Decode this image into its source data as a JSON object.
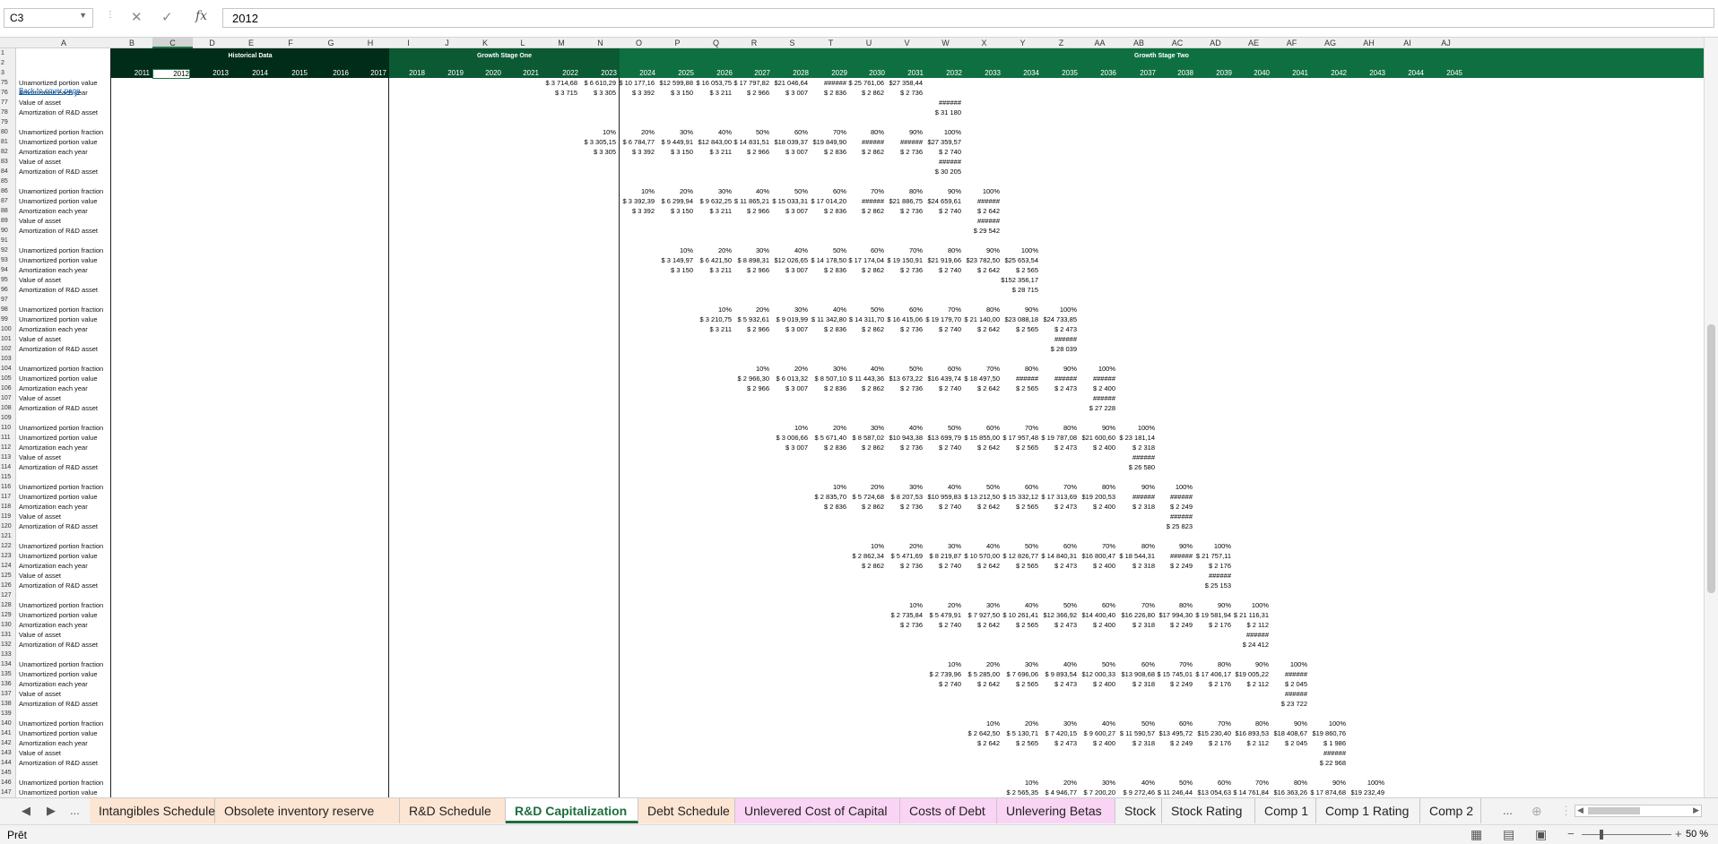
{
  "namebox": "C3",
  "formula": "2012",
  "back_link": "Back to cover page",
  "bands": {
    "hist": "Historical Data",
    "gs1": "Growth Stage One",
    "gs2": "Growth Stage Two"
  },
  "colors": {
    "dark_green": "#002d1a",
    "mid_green": "#0b5a34",
    "bright_green": "#0e7040",
    "accent": "#217346"
  },
  "columns": [
    "A",
    "B",
    "C",
    "D",
    "E",
    "F",
    "G",
    "H",
    "I",
    "J",
    "K",
    "L",
    "M",
    "N",
    "O",
    "P",
    "Q",
    "R",
    "S",
    "T",
    "U",
    "V",
    "W",
    "X",
    "Y",
    "Z",
    "AA",
    "AB",
    "AC",
    "AD",
    "AE",
    "AF",
    "AG",
    "AH",
    "AI",
    "AJ"
  ],
  "years": [
    "2011",
    "2012",
    "2013",
    "2014",
    "2015",
    "2016",
    "2017",
    "2018",
    "2019",
    "2020",
    "2021",
    "2022",
    "2023",
    "2024",
    "2025",
    "2026",
    "2027",
    "2028",
    "2029",
    "2030",
    "2031",
    "2032",
    "2033",
    "2034",
    "2035",
    "2036",
    "2037",
    "2038",
    "2039",
    "2040",
    "2041",
    "2042",
    "2043",
    "2044",
    "2045"
  ],
  "row_numbers": [
    "1",
    "2",
    "3",
    "75",
    "76",
    "77",
    "78",
    "79",
    "80",
    "81",
    "82",
    "83",
    "84",
    "85",
    "86",
    "87",
    "88",
    "89",
    "90",
    "91",
    "92",
    "93",
    "94",
    "95",
    "96",
    "97",
    "98",
    "99",
    "100",
    "101",
    "102",
    "103",
    "104",
    "105",
    "106",
    "107",
    "108",
    "109",
    "110",
    "111",
    "112",
    "113",
    "114",
    "115",
    "116",
    "117",
    "118",
    "119",
    "120",
    "121",
    "122",
    "123",
    "124",
    "125",
    "126",
    "127",
    "128",
    "129",
    "130",
    "131",
    "132",
    "133",
    "134",
    "135",
    "136",
    "137",
    "138",
    "139",
    "140",
    "141",
    "142",
    "143",
    "144",
    "145",
    "146",
    "147"
  ],
  "labels": {
    "frac": "Unamortized portion fraction",
    "val": "Unamortized portion value",
    "amort": "Amortization each year",
    "asset": "Value of asset",
    "rd": "Amortization of R&D asset"
  },
  "top_rows": {
    "r75": [
      "$ 3 714,68",
      "$ 6 610,29",
      "$ 10 177,16",
      "$12 599,88",
      "$ 16 053,75",
      "$ 17 797,82",
      "$21 046,64",
      "######",
      "$ 25 761,06",
      "$27 358,44"
    ],
    "r76": [
      "$ 3 715",
      "$ 3 305",
      "$ 3 392",
      "$ 3 150",
      "$ 3 211",
      "$ 2 966",
      "$ 3 007",
      "$ 2 836",
      "$ 2 862",
      "$ 2 736"
    ],
    "r77": [
      "######"
    ],
    "r78": [
      "$ 31 180"
    ]
  },
  "blocks": [
    {
      "frac": [
        "10%",
        "20%",
        "30%",
        "40%",
        "50%",
        "60%",
        "70%",
        "80%",
        "90%",
        "100%"
      ],
      "val": [
        "$ 3 305,15",
        "$ 6 784,77",
        "$ 9 449,91",
        "$12 843,00",
        "$ 14 831,51",
        "$18 039,37",
        "$19 849,90",
        "######",
        "######",
        "$27 359,57"
      ],
      "amort": [
        "$ 3 305",
        "$ 3 392",
        "$ 3 150",
        "$ 3 211",
        "$ 2 966",
        "$ 3 007",
        "$ 2 836",
        "$ 2 862",
        "$ 2 736",
        "$ 2 740"
      ],
      "asset": "######",
      "rd": "$ 30 205"
    },
    {
      "frac": [
        "10%",
        "20%",
        "30%",
        "40%",
        "50%",
        "60%",
        "70%",
        "80%",
        "90%",
        "100%"
      ],
      "val": [
        "$ 3 392,39",
        "$ 6 299,94",
        "$ 9 632,25",
        "$ 11 865,21",
        "$ 15 033,31",
        "$ 17 014,20",
        "######",
        "$21 886,75",
        "$24 659,61",
        "######"
      ],
      "amort": [
        "$ 3 392",
        "$ 3 150",
        "$ 3 211",
        "$ 2 966",
        "$ 3 007",
        "$ 2 836",
        "$ 2 862",
        "$ 2 736",
        "$ 2 740",
        "$ 2 642"
      ],
      "asset": "######",
      "rd": "$ 29 542"
    },
    {
      "frac": [
        "10%",
        "20%",
        "30%",
        "40%",
        "50%",
        "60%",
        "70%",
        "80%",
        "90%",
        "100%"
      ],
      "val": [
        "$ 3 149,97",
        "$ 6 421,50",
        "$ 8 898,31",
        "$12 026,65",
        "$ 14 178,50",
        "$ 17 174,04",
        "$ 19 150,91",
        "$21 919,66",
        "$23 782,50",
        "$25 653,54"
      ],
      "amort": [
        "$ 3 150",
        "$ 3 211",
        "$ 2 966",
        "$ 3 007",
        "$ 2 836",
        "$ 2 862",
        "$ 2 736",
        "$ 2 740",
        "$ 2 642",
        "$ 2 565"
      ],
      "asset": "$152 356,17",
      "rd": "$ 28 715"
    },
    {
      "frac": [
        "10%",
        "20%",
        "30%",
        "40%",
        "50%",
        "60%",
        "70%",
        "80%",
        "90%",
        "100%"
      ],
      "val": [
        "$ 3 210,75",
        "$ 5 932,61",
        "$ 9 019,99",
        "$ 11 342,80",
        "$ 14 311,70",
        "$ 16 415,06",
        "$ 19 179,70",
        "$ 21 140,00",
        "$23 088,18",
        "$24 733,85"
      ],
      "amort": [
        "$ 3 211",
        "$ 2 966",
        "$ 3 007",
        "$ 2 836",
        "$ 2 862",
        "$ 2 736",
        "$ 2 740",
        "$ 2 642",
        "$ 2 565",
        "$ 2 473"
      ],
      "asset": "######",
      "rd": "$ 28 039"
    },
    {
      "frac": [
        "10%",
        "20%",
        "30%",
        "40%",
        "50%",
        "60%",
        "70%",
        "80%",
        "90%",
        "100%"
      ],
      "val": [
        "$ 2 966,30",
        "$ 6 013,32",
        "$ 8 507,10",
        "$ 11 443,36",
        "$13 673,22",
        "$16 439,74",
        "$ 18 497,50",
        "######",
        "######",
        "######"
      ],
      "amort": [
        "$ 2 966",
        "$ 3 007",
        "$ 2 836",
        "$ 2 862",
        "$ 2 736",
        "$ 2 740",
        "$ 2 642",
        "$ 2 565",
        "$ 2 473",
        "$ 2 400"
      ],
      "asset": "######",
      "rd": "$ 27 228"
    },
    {
      "frac": [
        "10%",
        "20%",
        "30%",
        "40%",
        "50%",
        "60%",
        "70%",
        "80%",
        "90%",
        "100%"
      ],
      "val": [
        "$ 3 006,66",
        "$ 5 671,40",
        "$ 8 587,02",
        "$10 943,38",
        "$13 699,79",
        "$ 15 855,00",
        "$ 17 957,48",
        "$ 19 787,08",
        "$21 600,60",
        "$ 23 181,14"
      ],
      "amort": [
        "$ 3 007",
        "$ 2 836",
        "$ 2 862",
        "$ 2 736",
        "$ 2 740",
        "$ 2 642",
        "$ 2 565",
        "$ 2 473",
        "$ 2 400",
        "$ 2 318"
      ],
      "asset": "######",
      "rd": "$ 26 580"
    },
    {
      "frac": [
        "10%",
        "20%",
        "30%",
        "40%",
        "50%",
        "60%",
        "70%",
        "80%",
        "90%",
        "100%"
      ],
      "val": [
        "$ 2 835,70",
        "$ 5 724,68",
        "$ 8 207,53",
        "$10 959,83",
        "$ 13 212,50",
        "$ 15 332,12",
        "$ 17 313,69",
        "$19 200,53",
        "######",
        "######"
      ],
      "amort": [
        "$ 2 836",
        "$ 2 862",
        "$ 2 736",
        "$ 2 740",
        "$ 2 642",
        "$ 2 565",
        "$ 2 473",
        "$ 2 400",
        "$ 2 318",
        "$ 2 249"
      ],
      "asset": "######",
      "rd": "$ 25 823"
    },
    {
      "frac": [
        "10%",
        "20%",
        "30%",
        "40%",
        "50%",
        "60%",
        "70%",
        "80%",
        "90%",
        "100%"
      ],
      "val": [
        "$ 2 862,34",
        "$ 5 471,69",
        "$ 8 219,87",
        "$ 10 570,00",
        "$ 12 826,77",
        "$ 14 840,31",
        "$16 800,47",
        "$ 18 544,31",
        "######",
        "$ 21 757,11"
      ],
      "amort": [
        "$ 2 862",
        "$ 2 736",
        "$ 2 740",
        "$ 2 642",
        "$ 2 565",
        "$ 2 473",
        "$ 2 400",
        "$ 2 318",
        "$ 2 249",
        "$ 2 176"
      ],
      "asset": "######",
      "rd": "$ 25 153"
    },
    {
      "frac": [
        "10%",
        "20%",
        "30%",
        "40%",
        "50%",
        "60%",
        "70%",
        "80%",
        "90%",
        "100%"
      ],
      "val": [
        "$ 2 735,84",
        "$ 5 479,91",
        "$ 7 927,50",
        "$ 10 261,41",
        "$12 366,92",
        "$14 400,40",
        "$16 226,80",
        "$17 994,30",
        "$ 19 581,94",
        "$ 21 116,31"
      ],
      "amort": [
        "$ 2 736",
        "$ 2 740",
        "$ 2 642",
        "$ 2 565",
        "$ 2 473",
        "$ 2 400",
        "$ 2 318",
        "$ 2 249",
        "$ 2 176",
        "$ 2 112"
      ],
      "asset": "######",
      "rd": "$ 24 412"
    },
    {
      "frac": [
        "10%",
        "20%",
        "30%",
        "40%",
        "50%",
        "60%",
        "70%",
        "80%",
        "90%",
        "100%"
      ],
      "val": [
        "$ 2 739,96",
        "$ 5 285,00",
        "$ 7 696,06",
        "$ 9 893,54",
        "$12 000,33",
        "$13 908,68",
        "$ 15 745,01",
        "$ 17 406,17",
        "$19 005,22",
        "######"
      ],
      "amort": [
        "$ 2 740",
        "$ 2 642",
        "$ 2 565",
        "$ 2 473",
        "$ 2 400",
        "$ 2 318",
        "$ 2 249",
        "$ 2 176",
        "$ 2 112",
        "$ 2 045"
      ],
      "asset": "######",
      "rd": "$ 23 722"
    },
    {
      "frac": [
        "10%",
        "20%",
        "30%",
        "40%",
        "50%",
        "60%",
        "70%",
        "80%",
        "90%",
        "100%"
      ],
      "val": [
        "$ 2 642,50",
        "$ 5 130,71",
        "$ 7 420,15",
        "$ 9 600,27",
        "$ 11 590,57",
        "$13 495,72",
        "$15 230,40",
        "$16 893,53",
        "$18 408,67",
        "$19 860,76"
      ],
      "amort": [
        "$ 2 642",
        "$ 2 565",
        "$ 2 473",
        "$ 2 400",
        "$ 2 318",
        "$ 2 249",
        "$ 2 176",
        "$ 2 112",
        "$ 2 045",
        "$ 1 986"
      ],
      "asset": "######",
      "rd": "$ 22 968"
    },
    {
      "frac": [
        "10%",
        "20%",
        "30%",
        "40%",
        "50%",
        "60%",
        "70%",
        "80%",
        "90%",
        "100%"
      ],
      "val": [
        "$ 2 565,35",
        "$ 4 946,77",
        "$ 7 200,20",
        "$ 9 272,46",
        "$ 11 246,44",
        "$13 054,63",
        "$ 14 761,84",
        "$16 363,26",
        "$ 17 874,68",
        "$19 232,49"
      ]
    }
  ],
  "sheet_tabs": [
    {
      "label": "Intangibles Schedule",
      "color": "#fde5d3"
    },
    {
      "label": "Obsolete inventory reserve",
      "color": "#fde5d3"
    },
    {
      "label": "R&D Schedule",
      "color": "#fde5d3"
    },
    {
      "label": "R&D Capitalization",
      "color": "#ffffff"
    },
    {
      "label": "Debt Schedule",
      "color": "#fde5d3"
    },
    {
      "label": "Unlevered Cost of Capital",
      "color": "#f9d4f4"
    },
    {
      "label": "Costs of Debt",
      "color": "#f9d4f4"
    },
    {
      "label": "Unlevering Betas",
      "color": "#f9d4f4"
    },
    {
      "label": "Stock",
      "color": "#f3f3f3"
    },
    {
      "label": "Stock Rating",
      "color": "#f3f3f3"
    },
    {
      "label": "Comp 1",
      "color": "#f3f3f3"
    },
    {
      "label": "Comp 1 Rating",
      "color": "#f3f3f3"
    },
    {
      "label": "Comp 2",
      "color": "#f3f3f3"
    }
  ],
  "tab_ellipsis": "...",
  "status": {
    "ready": "Prêt",
    "zoom": "50 %"
  }
}
